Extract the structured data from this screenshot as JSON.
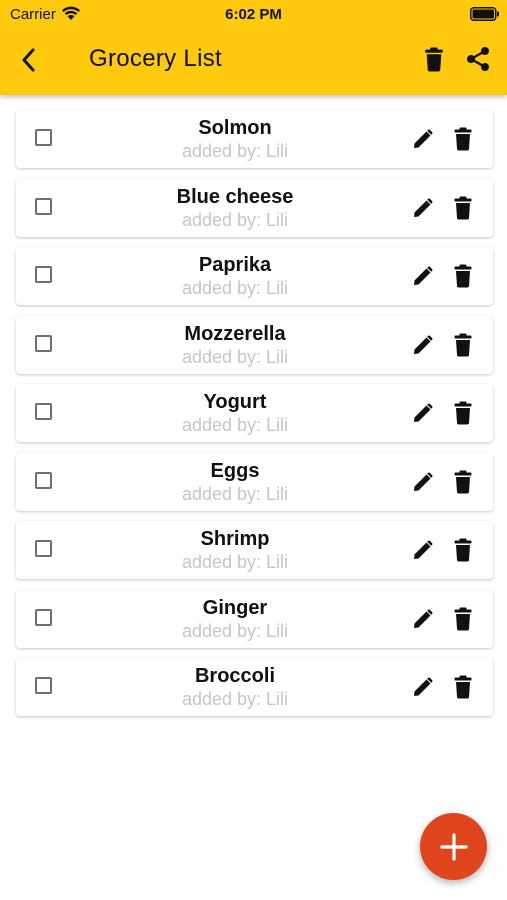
{
  "status_bar": {
    "carrier": "Carrier",
    "time": "6:02 PM",
    "wifi_icon": "wifi-icon",
    "battery_icon": "battery-full-icon"
  },
  "app_bar": {
    "title": "Grocery List",
    "back_icon": "chevron-left-icon",
    "delete_all_icon": "trash-icon",
    "share_icon": "share-icon",
    "background_color": "#FFC90E"
  },
  "items": [
    {
      "name": "Solmon",
      "added_by": "added by: Lili",
      "checked": false
    },
    {
      "name": "Blue cheese",
      "added_by": "added by: Lili",
      "checked": false
    },
    {
      "name": "Paprika",
      "added_by": "added by: Lili",
      "checked": false
    },
    {
      "name": "Mozzerella",
      "added_by": "added by: Lili",
      "checked": false
    },
    {
      "name": "Yogurt",
      "added_by": "added by: Lili",
      "checked": false
    },
    {
      "name": "Eggs",
      "added_by": "added by: Lili",
      "checked": false
    },
    {
      "name": "Shrimp",
      "added_by": "added by: Lili",
      "checked": false
    },
    {
      "name": "Ginger",
      "added_by": "added by: Lili",
      "checked": false
    },
    {
      "name": "Broccoli",
      "added_by": "added by: Lili",
      "checked": false
    }
  ],
  "item_icons": {
    "edit_icon": "pencil-icon",
    "delete_icon": "trash-icon"
  },
  "fab": {
    "icon": "plus-icon",
    "color": "#E0461E"
  }
}
